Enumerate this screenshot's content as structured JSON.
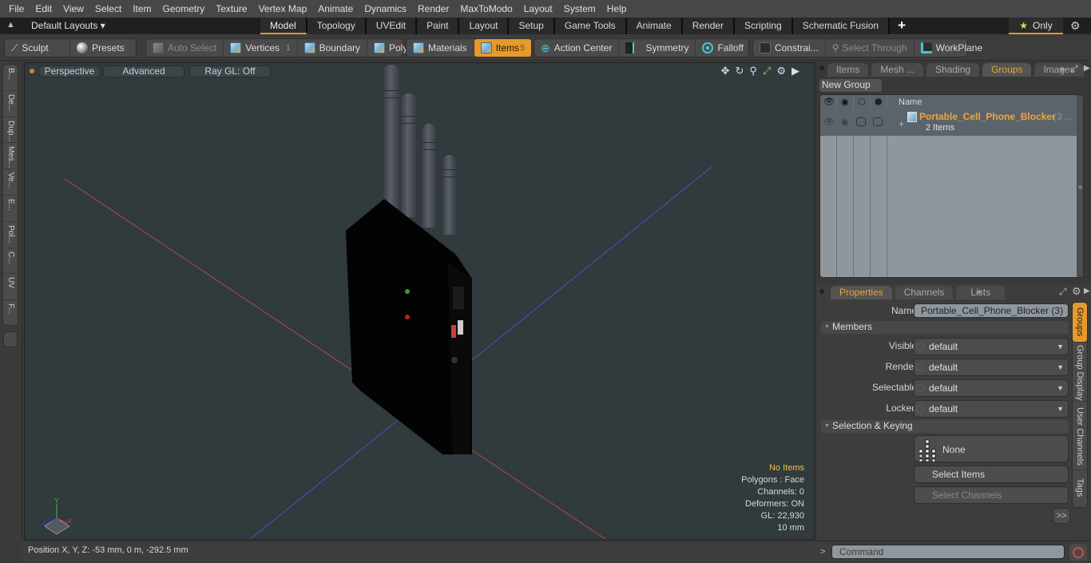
{
  "menu": [
    "File",
    "Edit",
    "View",
    "Select",
    "Item",
    "Geometry",
    "Texture",
    "Vertex Map",
    "Animate",
    "Dynamics",
    "Render",
    "MaxToModo",
    "Layout",
    "System",
    "Help"
  ],
  "layout_bar": {
    "layout_dropdown": "Default Layouts ▾",
    "mode_tabs": [
      "Model",
      "Topology",
      "UVEdit",
      "Paint",
      "Layout",
      "Setup",
      "Game Tools",
      "Animate",
      "Render",
      "Scripting",
      "Schematic Fusion"
    ],
    "active_mode": "Model",
    "add_tab": "+",
    "only_label": "Only"
  },
  "toolbar": {
    "sculpt": "Sculpt",
    "presets": "Presets",
    "auto_select": "Auto Select",
    "vertices": "Vertices",
    "vertices_count": "1",
    "boundary": "Boundary",
    "polygons": "Polygons",
    "materials": "Materials",
    "items": "Items",
    "items_count": "5",
    "action_center": "Action Center",
    "symmetry": "Symmetry",
    "falloff": "Falloff",
    "constraints": "Constrai...",
    "select_through": "Select Through",
    "workplane": "WorkPlane"
  },
  "left_tabs": [
    "B...",
    "De...",
    "Dup...",
    "Mes...",
    "Ve...",
    "E...",
    "Pol...",
    "C...",
    "UV",
    "F..."
  ],
  "viewport": {
    "view_mode": "Perspective",
    "shading": "Advanced",
    "ray_gl": "Ray GL: Off",
    "info": {
      "items": "No Items",
      "polygons": "Polygons : Face",
      "channels": "Channels: 0",
      "deformers": "Deformers: ON",
      "gl": "GL: 22,930",
      "unit": "10 mm"
    },
    "axis": {
      "x": "X",
      "y": "Y",
      "z": "Z"
    }
  },
  "status": {
    "position": "Position X, Y, Z:   -53 mm, 0 m, -292.5 mm"
  },
  "groups_panel": {
    "tabs": [
      "Items",
      "Mesh ...",
      "Shading",
      "Groups",
      "Images"
    ],
    "active_tab": "Groups",
    "new_group": "New Group",
    "column_name": "Name",
    "rows": [
      {
        "name": "Portable_Cell_Phone_Blocker",
        "suffix": "(3 ...",
        "sub": "2 Items"
      }
    ]
  },
  "properties_panel": {
    "tabs": [
      "Properties",
      "Channels",
      "Lists"
    ],
    "active_tab": "Properties",
    "name_label": "Name",
    "name_value": "Portable_Cell_Phone_Blocker (3)",
    "members_section": "Members",
    "fields": [
      {
        "label": "Visible",
        "value": "default"
      },
      {
        "label": "Render",
        "value": "default"
      },
      {
        "label": "Selectable",
        "value": "default"
      },
      {
        "label": "Locked",
        "value": "default"
      }
    ],
    "selection_section": "Selection & Keying",
    "none_label": "None",
    "select_items": "Select Items",
    "select_channels": "Select Channels",
    "more": ">>",
    "side_tabs": [
      "Groups",
      "Group Display",
      "User Channels",
      "Tags"
    ]
  },
  "command": {
    "prompt": ">",
    "placeholder": "Command"
  }
}
